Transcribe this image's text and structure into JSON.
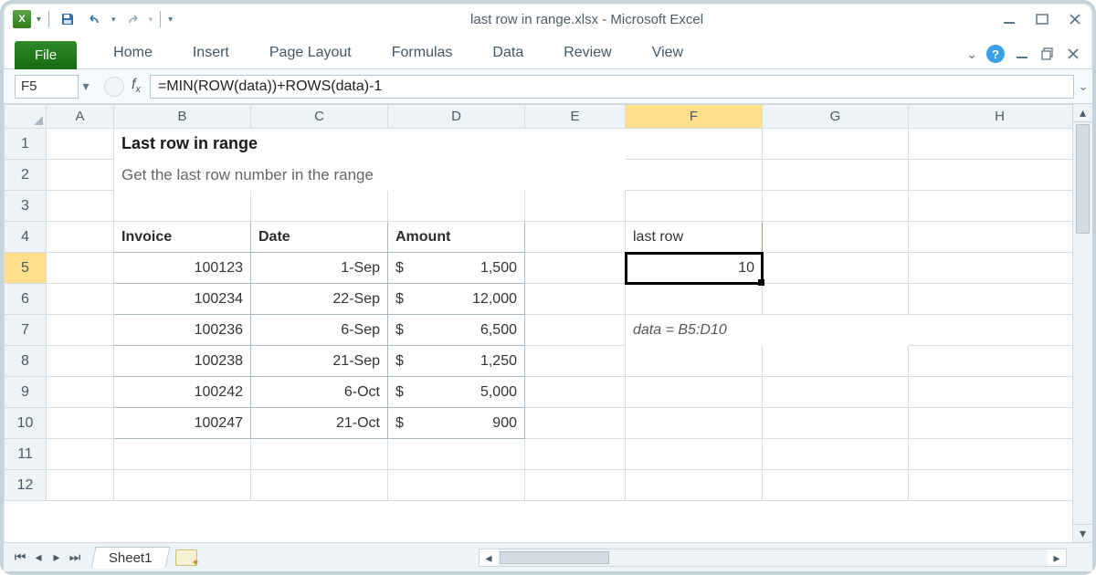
{
  "window": {
    "title": "last row in range.xlsx  -  Microsoft Excel"
  },
  "ribbon": {
    "file": "File",
    "tabs": [
      "Home",
      "Insert",
      "Page Layout",
      "Formulas",
      "Data",
      "Review",
      "View"
    ]
  },
  "namebox": "F5",
  "formula": "=MIN(ROW(data))+ROWS(data)-1",
  "columns": [
    "A",
    "B",
    "C",
    "D",
    "E",
    "F",
    "G",
    "H"
  ],
  "row_count": 12,
  "content": {
    "title": "Last row in range",
    "subtitle": "Get the last row number in the range",
    "table_headers": {
      "invoice": "Invoice",
      "date": "Date",
      "amount": "Amount"
    },
    "rows": [
      {
        "invoice": "100123",
        "date": "1-Sep",
        "amount": "1,500"
      },
      {
        "invoice": "100234",
        "date": "22-Sep",
        "amount": "12,000"
      },
      {
        "invoice": "100236",
        "date": "6-Sep",
        "amount": "6,500"
      },
      {
        "invoice": "100238",
        "date": "21-Sep",
        "amount": "1,250"
      },
      {
        "invoice": "100242",
        "date": "6-Oct",
        "amount": "5,000"
      },
      {
        "invoice": "100247",
        "date": "21-Oct",
        "amount": "900"
      }
    ],
    "currency": "$",
    "lastrow_label": "last row",
    "lastrow_value": "10",
    "note": "data = B5:D10"
  },
  "sheet_tab": "Sheet1",
  "chart_data": {
    "type": "table",
    "title": "Last row in range",
    "columns": [
      "Invoice",
      "Date",
      "Amount"
    ],
    "rows": [
      [
        "100123",
        "1-Sep",
        1500
      ],
      [
        "100234",
        "22-Sep",
        12000
      ],
      [
        "100236",
        "6-Sep",
        6500
      ],
      [
        "100238",
        "21-Sep",
        1250
      ],
      [
        "100242",
        "6-Oct",
        5000
      ],
      [
        "100247",
        "21-Oct",
        900
      ]
    ],
    "derived": {
      "last_row": 10,
      "named_range": "data = B5:D10"
    }
  }
}
